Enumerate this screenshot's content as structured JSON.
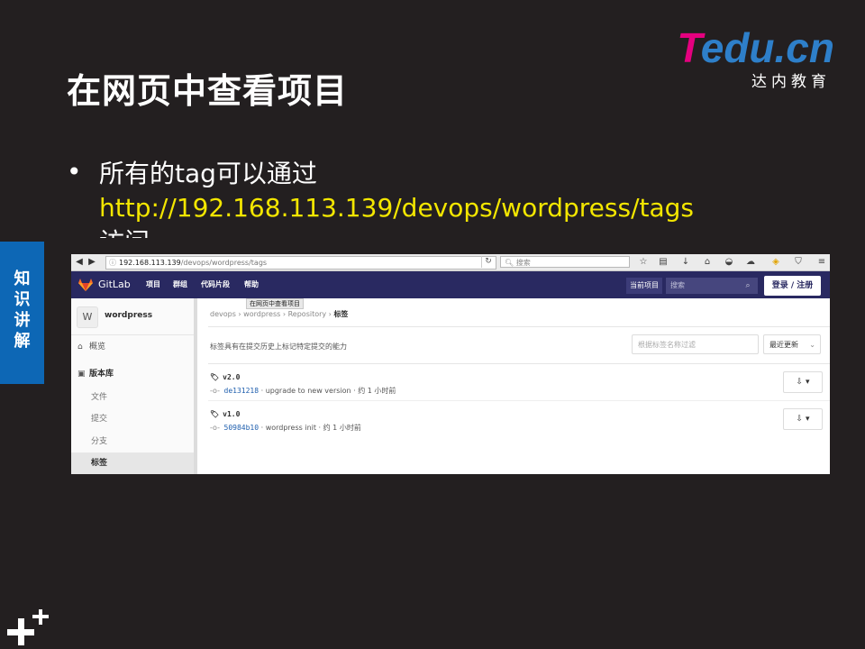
{
  "slide": {
    "title": "在网页中查看项目",
    "side_tab": [
      "知",
      "识",
      "讲",
      "解"
    ],
    "bullet_text": "所有的tag可以通过",
    "bullet_url": "http://192.168.113.139/devops/wordpress/tags",
    "bullet_tail": "访问",
    "logo": {
      "word": "Tedu.cn",
      "sub": "达内教育",
      "colors": {
        "t": "#e5007f",
        "rest": "#2e7fc9"
      }
    }
  },
  "browser": {
    "url_host": "192.168.113.139",
    "url_path": "/devops/wordpress/tags",
    "search_placeholder": "搜索"
  },
  "gitlab": {
    "brand": "GitLab",
    "menu": [
      "项目",
      "群组",
      "代码片段",
      "帮助"
    ],
    "current_project": "当前项目",
    "search_placeholder": "搜索",
    "login_label": "登录 / 注册",
    "colors": {
      "nav": "#292961",
      "link": "#1f5fae"
    }
  },
  "sidebar": {
    "avatar_letter": "W",
    "project_name": "wordpress",
    "overview": "概览",
    "repository": "版本库",
    "sub_items": [
      "文件",
      "提交",
      "分支",
      "标签"
    ],
    "active": "标签"
  },
  "main": {
    "breadcrumb": [
      "devops",
      "wordpress",
      "Repository",
      "标签"
    ],
    "tooltip": "在网页中查看项目",
    "description": "标签具有在提交历史上标记特定提交的能力",
    "filter_placeholder": "根据标签名称过滤",
    "sort_label": "最近更新",
    "tags": [
      {
        "name": "v2.0",
        "sha": "de131218",
        "message": "upgrade to new version",
        "time": "约 1 小时前"
      },
      {
        "name": "v1.0",
        "sha": "50984b10",
        "message": "wordpress init",
        "time": "约 1 小时前"
      }
    ]
  }
}
